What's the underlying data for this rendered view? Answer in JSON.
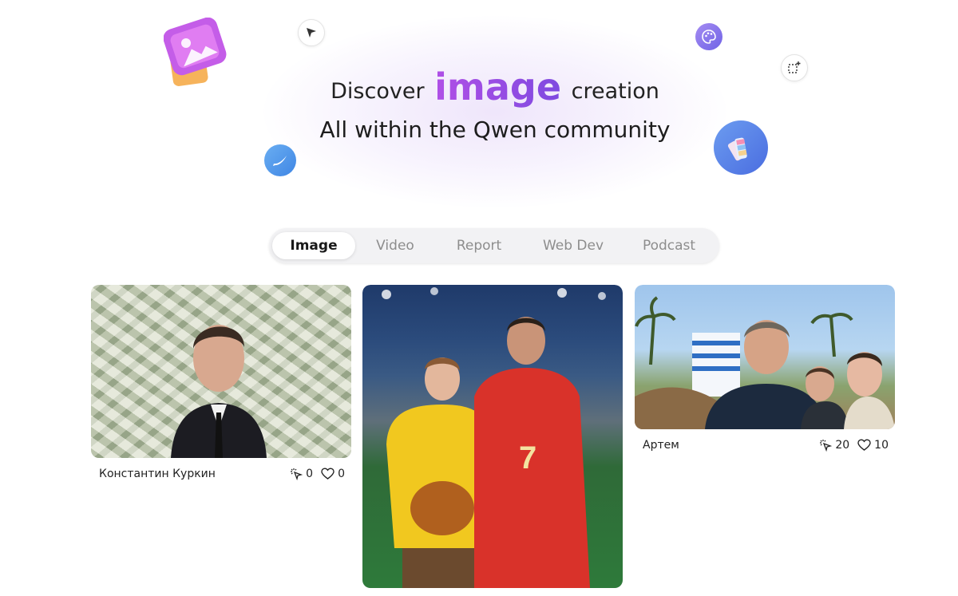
{
  "hero": {
    "line1_before": "Discover",
    "line1_accent": "image",
    "line1_after": "creation",
    "line2": "All within the Qwen community"
  },
  "decor_icons": [
    "image-app-icon",
    "cursor-icon",
    "palette-icon",
    "select-sparkle-icon",
    "brush-icon",
    "swatches-icon"
  ],
  "tabs": [
    {
      "label": "Image",
      "active": true
    },
    {
      "label": "Video",
      "active": false
    },
    {
      "label": "Report",
      "active": false
    },
    {
      "label": "Web Dev",
      "active": false
    },
    {
      "label": "Podcast",
      "active": false
    }
  ],
  "cards": [
    {
      "author": "Константин Куркин",
      "clicks": "0",
      "likes": "0"
    },
    {
      "author": "",
      "clicks": "",
      "likes": ""
    },
    {
      "author": "Артем",
      "clicks": "20",
      "likes": "10"
    }
  ],
  "colors": {
    "accent_start": "#b04fe6",
    "accent_end": "#7f4ae0",
    "tab_bg": "#f2f2f4",
    "tab_inactive_text": "#8d8d8d"
  }
}
